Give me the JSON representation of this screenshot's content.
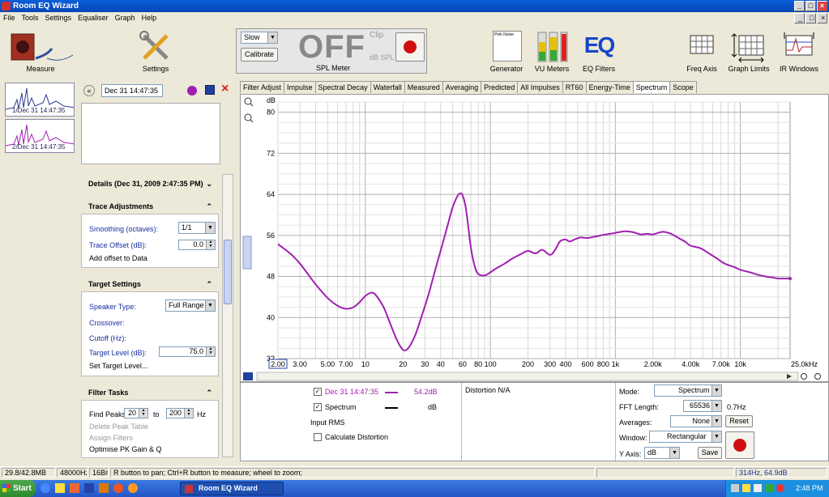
{
  "window": {
    "title": "Room EQ Wizard"
  },
  "menu": [
    "File",
    "Tools",
    "Settings",
    "Equaliser",
    "Graph",
    "Help"
  ],
  "toolbar": {
    "measure": "Measure",
    "settings": "Settings",
    "spl": {
      "speed": "Slow",
      "calibrate": "Calibrate",
      "value": "OFF",
      "clip": "Clip",
      "unit": "dB SPL",
      "label": "SPL Meter"
    },
    "generator": "Generator",
    "generator_title": "Pink Noise",
    "vu": "VU Meters",
    "eq": "EQ Filters",
    "eq_logo": "EQ",
    "freq_axis": "Freq Axis",
    "graph_limits": "Graph Limits",
    "ir_windows": "IR Windows"
  },
  "measurements": [
    {
      "label": "1/Dec 31 14:47:35"
    },
    {
      "label": "2/Dec 31 14:47:35"
    }
  ],
  "left": {
    "name_value": "Dec 31 14:47:35",
    "details_title": "Details  (Dec 31, 2009 2:47:35 PM)",
    "trace": {
      "title": "Trace Adjustments",
      "smoothing_label": "Smoothing (octaves):",
      "smoothing_value": "1/1",
      "offset_label": "Trace Offset (dB):",
      "offset_value": "0.0",
      "add_offset": "Add offset to Data"
    },
    "target": {
      "title": "Target Settings",
      "speaker_label": "Speaker Type:",
      "speaker_value": "Full Range",
      "crossover": "Crossover:",
      "cutoff": "Cutoff (Hz):",
      "level_label": "Target Level (dB):",
      "level_value": "75.0",
      "set_level": "Set Target Level..."
    },
    "filter": {
      "title": "Filter Tasks",
      "find_peaks": "Find Peaks",
      "from": "20",
      "to_label": "to",
      "to": "200",
      "hz": "Hz",
      "delete": "Delete Peak Table",
      "assign": "Assign Filters",
      "optimise": "Optimise PK Gain & Q"
    }
  },
  "tabs": [
    "Filter Adjust",
    "Impulse",
    "Spectral Decay",
    "Waterfall",
    "Measured",
    "Averaging",
    "Predicted",
    "All Impulses",
    "RT60",
    "Energy-Time",
    "Spectrum",
    "Scope"
  ],
  "active_tab": "Spectrum",
  "chart_data": {
    "type": "line",
    "ylabel": "dB",
    "ylim": [
      32,
      82
    ],
    "yticks": [
      32,
      40,
      48,
      56,
      64,
      72,
      80
    ],
    "xlim": [
      2,
      25000
    ],
    "xscale": "log",
    "xtick_labels": [
      {
        "v": 2,
        "t": "2.00"
      },
      {
        "v": 3,
        "t": "3.00"
      },
      {
        "v": 5,
        "t": "5.00"
      },
      {
        "v": 7,
        "t": "7.00"
      },
      {
        "v": 10,
        "t": "10"
      },
      {
        "v": 20,
        "t": "20"
      },
      {
        "v": 30,
        "t": "30"
      },
      {
        "v": 40,
        "t": "40"
      },
      {
        "v": 60,
        "t": "60"
      },
      {
        "v": 80,
        "t": "80"
      },
      {
        "v": 100,
        "t": "100"
      },
      {
        "v": 200,
        "t": "200"
      },
      {
        "v": 300,
        "t": "300"
      },
      {
        "v": 400,
        "t": "400"
      },
      {
        "v": 600,
        "t": "600"
      },
      {
        "v": 800,
        "t": "800"
      },
      {
        "v": 1000,
        "t": "1k"
      },
      {
        "v": 2000,
        "t": "2.00k"
      },
      {
        "v": 4000,
        "t": "4.00k"
      },
      {
        "v": 7000,
        "t": "7.00k"
      },
      {
        "v": 10000,
        "t": "10k"
      },
      {
        "v": 25000,
        "t": "25.0kHz"
      }
    ],
    "series": [
      {
        "name": "Dec 31 14:47:35",
        "color": "#a020b0",
        "x": [
          2,
          2.5,
          3,
          4,
          5,
          6,
          7,
          8,
          9,
          10,
          11,
          12,
          14,
          16,
          18,
          20,
          22,
          25,
          28,
          32,
          36,
          40,
          45,
          50,
          55,
          58,
          60,
          63,
          66,
          70,
          75,
          80,
          90,
          100,
          110,
          130,
          150,
          180,
          200,
          230,
          260,
          300,
          330,
          360,
          400,
          430,
          480,
          530,
          600,
          700,
          800,
          900,
          1000,
          1200,
          1400,
          1600,
          1800,
          2000,
          2400,
          2800,
          3200,
          3600,
          4000,
          4800,
          5600,
          6500,
          7500,
          9000,
          10000,
          12000,
          14000,
          16000,
          18000,
          20000,
          22000,
          25000
        ],
        "y": [
          54.3,
          52.5,
          50.5,
          46.5,
          43.8,
          42.3,
          41.7,
          42,
          43,
          44.2,
          44.8,
          44.5,
          42,
          38.5,
          35.5,
          33.7,
          34,
          36.5,
          40,
          44.5,
          49,
          53,
          57.5,
          61.5,
          63.8,
          64.2,
          63.8,
          62,
          58.5,
          53.5,
          50,
          48.5,
          48.2,
          48.8,
          49.5,
          50.5,
          51.5,
          52.5,
          53,
          52.5,
          53.2,
          52.2,
          53.2,
          54.8,
          55.2,
          54.8,
          55.3,
          55.6,
          55.5,
          55.8,
          56.1,
          56.3,
          56.5,
          56.8,
          56.6,
          56.2,
          56.3,
          56.2,
          56.7,
          56.3,
          55.5,
          54.8,
          54,
          53.5,
          52.5,
          51.5,
          50.5,
          49.8,
          49.3,
          48.8,
          48.3,
          48,
          47.8,
          47.6,
          47.6,
          47.6
        ]
      }
    ]
  },
  "controls": {
    "trace1": "Dec 31 14:47:35",
    "trace1_value": "54.2dB",
    "trace1_color": "#a020b0",
    "trace2": "Spectrum",
    "trace2_value": "dB",
    "input_rms": "Input RMS",
    "calc_dist": "Calculate Distortion",
    "distortion": "Distortion N/A",
    "mode_label": "Mode:",
    "mode_value": "Spectrum",
    "fft_label": "FFT Length:",
    "fft_value": "65536",
    "fft_res": "0.7Hz",
    "avg_label": "Averages:",
    "avg_value": "None",
    "reset": "Reset",
    "window_label": "Window:",
    "window_value": "Rectangular",
    "yaxis_label": "Y Axis:",
    "yaxis_value": "dB",
    "save": "Save"
  },
  "status": {
    "memory": "29.8/42.8MB",
    "rate": "48000Hz",
    "bits": "16Bit",
    "hint": "R button to pan; Ctrl+R button to measure; wheel to zoom;",
    "cursor": "314Hz, 64.9dB"
  },
  "taskbar": {
    "start": "Start",
    "app": "Room EQ Wizard",
    "clock": "2:48 PM"
  }
}
